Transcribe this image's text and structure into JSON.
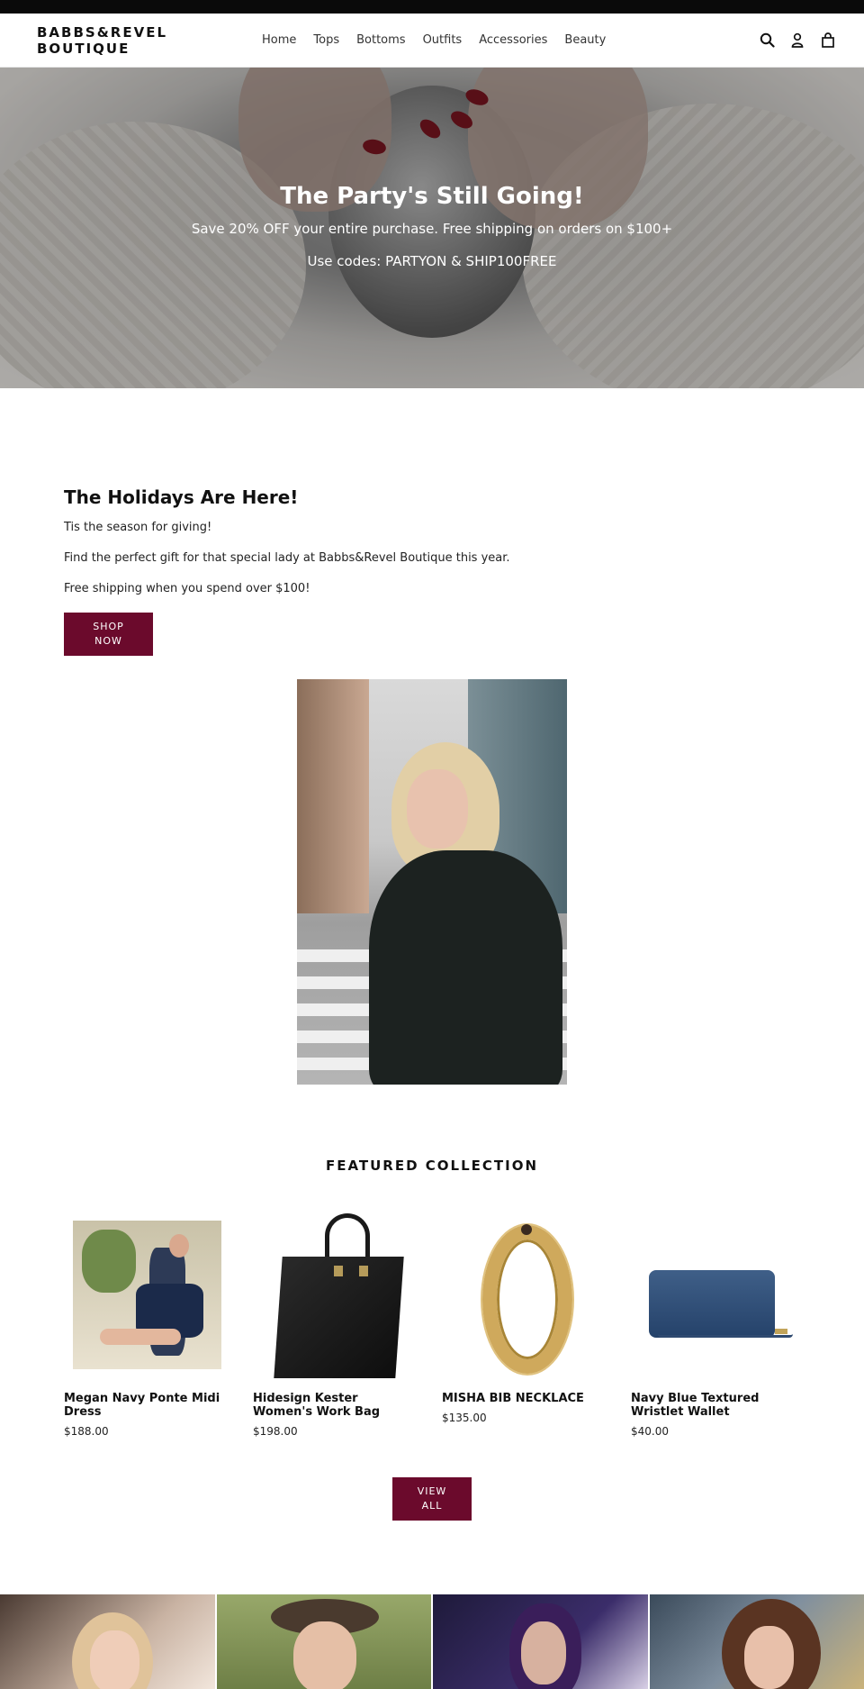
{
  "header": {
    "logo": "BABBS&REVEL BOUTIQUE",
    "nav": [
      "Home",
      "Tops",
      "Bottoms",
      "Outfits",
      "Accessories",
      "Beauty"
    ],
    "icons": [
      "search-icon",
      "account-icon",
      "cart-icon"
    ]
  },
  "hero": {
    "title": "The Party's Still Going!",
    "subtitle": "Save 20% OFF your entire purchase. Free shipping on orders on $100+",
    "codes": "Use codes: PARTYON & SHIP100FREE"
  },
  "promo": {
    "heading": "The Holidays Are Here!",
    "lines": [
      "Tis the season for giving!",
      "Find the perfect gift for that special lady at Babbs&Revel Boutique this year.",
      "Free shipping when you spend over $100!"
    ],
    "button": "SHOP NOW"
  },
  "featured": {
    "title": "FEATURED COLLECTION",
    "products": [
      {
        "name": "Megan Navy Ponte Midi Dress",
        "price": "$188.00"
      },
      {
        "name": "Hidesign Kester Women's Work Bag",
        "price": "$198.00"
      },
      {
        "name": "MISHA BIB NECKLACE",
        "price": "$135.00"
      },
      {
        "name": "Navy Blue Textured Wristlet Wallet",
        "price": "$40.00"
      }
    ],
    "view_all": "VIEW ALL"
  },
  "colors": {
    "accent": "#6b0a2c",
    "topbar": "#0a0a0a"
  }
}
